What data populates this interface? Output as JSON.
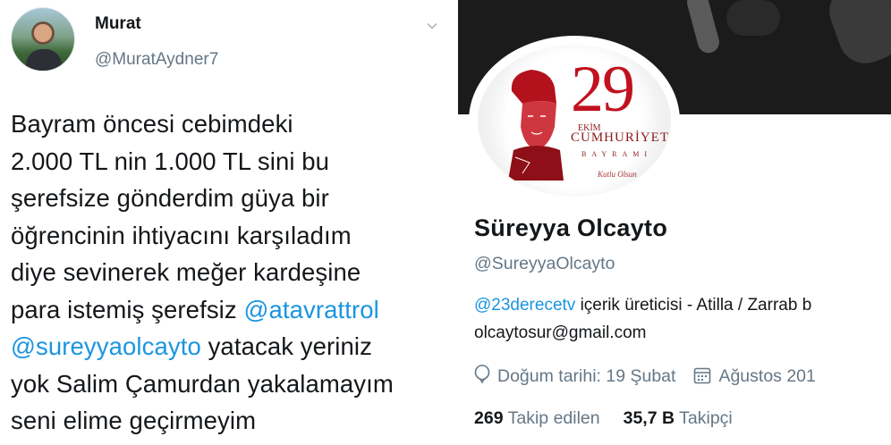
{
  "tweet": {
    "author_name": "Murat",
    "author_handle": "@MuratAydner7",
    "lines": [
      {
        "text": "Bayram öncesi cebimdeki"
      },
      {
        "text": "2.000 TL nin 1.000 TL sini bu"
      },
      {
        "text": "şerefsize gönderdim güya bir"
      },
      {
        "text": "öğrencinin ihtiyacını karşıladım"
      },
      {
        "text": "diye sevinerek meğer kardeşine"
      },
      {
        "pre": "para istemiş şerefsiz ",
        "mention": "@atavrattrol"
      },
      {
        "mention": "@sureyyaolcayto",
        "post": " yatacak yeriniz"
      },
      {
        "text": "yok Salim Çamurdan yakalamayım"
      },
      {
        "text": "seni elime geçirmeyim"
      }
    ]
  },
  "profile": {
    "avatar_graphic": {
      "number": "29",
      "ekim": "EKİM",
      "title": "CUMHURİYET",
      "subtitle": "BAYRAMI",
      "signature": "Kutlu Olsun"
    },
    "display_name": "Süreyya Olcayto",
    "handle": "@SureyyaOlcayto",
    "bio_mention": "@23derecetv",
    "bio_text": " içerik üreticisi - Atilla / Zarrab b",
    "bio_email": "olcaytosur@gmail.com",
    "birthday": "Doğum tarihi: 19 Şubat",
    "joined": "Ağustos 201",
    "following_count": "269",
    "following_label": "Takip edilen",
    "followers_count": "35,7 B",
    "followers_label": "Takipçi"
  },
  "colors": {
    "link": "#1b95e0",
    "secondary": "#657786",
    "primary_text": "#14171a",
    "accent_red": "#c1121f"
  },
  "icons": {
    "tweet_menu": "chevron-down-icon",
    "birthday": "balloon-icon",
    "joined": "calendar-icon"
  }
}
